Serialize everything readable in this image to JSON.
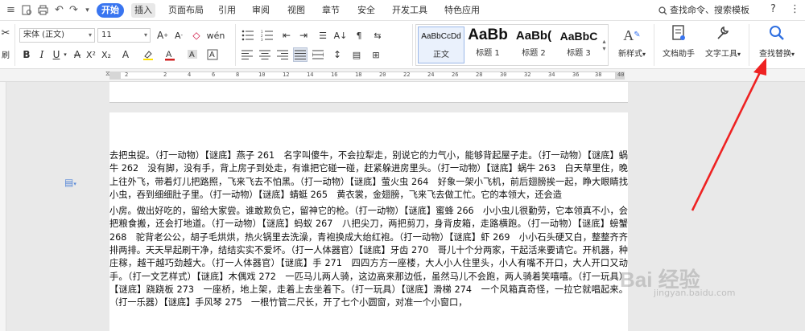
{
  "menubar": {
    "quick_icons": [
      "menu-icon",
      "print-preview-icon",
      "print-icon",
      "undo-icon",
      "redo-icon",
      "dropdown-icon"
    ],
    "tabs": [
      {
        "label": "开始",
        "active": true
      },
      {
        "label": "插入",
        "active": false
      },
      {
        "label": "页面布局",
        "active": false
      },
      {
        "label": "引用",
        "active": false
      },
      {
        "label": "审阅",
        "active": false
      },
      {
        "label": "视图",
        "active": false
      },
      {
        "label": "章节",
        "active": false
      },
      {
        "label": "安全",
        "active": false
      },
      {
        "label": "开发工具",
        "active": false
      },
      {
        "label": "特色应用",
        "active": false
      }
    ],
    "search_label": "查找命令、搜索模板",
    "help": "?",
    "more": "⋮"
  },
  "ribbon": {
    "font_name": "宋体 (正文)",
    "font_size": "11",
    "style_samples": [
      {
        "sample": "AaBbCcDd",
        "name": "正文"
      },
      {
        "sample": "AaBb",
        "name": "标题 1"
      },
      {
        "sample": "AaBb(",
        "name": "标题 2"
      },
      {
        "sample": "AaBbC",
        "name": "标题 3"
      }
    ],
    "new_style": "新样式",
    "doc_assistant": "文档助手",
    "text_tools": "文字工具",
    "find_replace": "查找替换",
    "accent_color": "#3975f0",
    "font_color": "#d02020",
    "highlight_color": "#ffe000"
  },
  "ruler": {
    "numbers": [
      "2",
      "2",
      "4",
      "6",
      "8",
      "10",
      "12",
      "14",
      "16",
      "18",
      "20",
      "22",
      "24",
      "26",
      "28",
      "30",
      "32",
      "34",
      "36",
      "38",
      "40"
    ]
  },
  "document": {
    "paragraph1": "去把虫捉。（打一动物）【谜底】燕子 261　名字叫傻牛，不会拉犁走，别说它的力气小，能够背起屋子走。（打一动物）【谜底】蜗牛 262　没有脚，没有手，背上房子到处走，有谁把它碰一碰，赶紧躲进房里头。（打一动物）【谜底】蜗牛 263　白天草里住，晚上往外飞，带着灯儿把路照，飞来飞去不怕黑。（打一动物）【谜底】萤火虫 264　好象一架小飞机，前后翅膀挨一起，睁大眼睛找小虫，吞到细细肚子里。（打一动物）【谜底】蜻蜓 265　黄衣裳，金翅膀，飞来飞去做工忙。它的本领大，还会造",
    "paragraph2": "小房。做出好吃的，留给大家尝。谁敢欺负它，留神它的枪。（打一动物）【谜底】蜜蜂 266　小小虫儿很勤劳，它本领真不小，会把粮食搬，还会打地道。（打一动物）【谜底】蚂蚁 267　八把尖刀，两把剪刀，身背皮箱，走路横跑。（打一动物）【谜底】螃蟹 268　驼背老公公，胡子毛烘烘，热火锅里去洗澡，青袍换成大绐红袍。（打一动物）【谜底】虾 269　小小石头硬又白，整整齐齐排两排。天天早起刷干净，结结实实不爱坏。（打一人体器官）【谜底】牙齿 270　哥儿十个分两家，干起活来要请它。开机器，种庄稼，越干越巧劲越大。（打一人体器官）【谜底】手 271　四四方方一座楼，大人小人住里头，小人有嘴不开口，大人开口又动手。（打一文艺样式）【谜底】木偶戏 272　一匹马儿两人骑，这边高来那边低，虽然马儿不会跑，两人骑着笑嘻嘻。（打一玩具）【谜底】跷跷板 273　一座桥，地上架，走着上去坐着下。（打一玩具）【谜底】滑梯 274　一个风箱真奇怪，一拉它就唱起来。（打一乐器）【谜底】手风琴 275　一根竹管二尺长，开了七个小圆窗，对准一个小窗口，"
  },
  "watermark": {
    "text": "Bai 经验",
    "sub": "jingyan.baidu.com"
  },
  "annotation_color": "#ee2222"
}
